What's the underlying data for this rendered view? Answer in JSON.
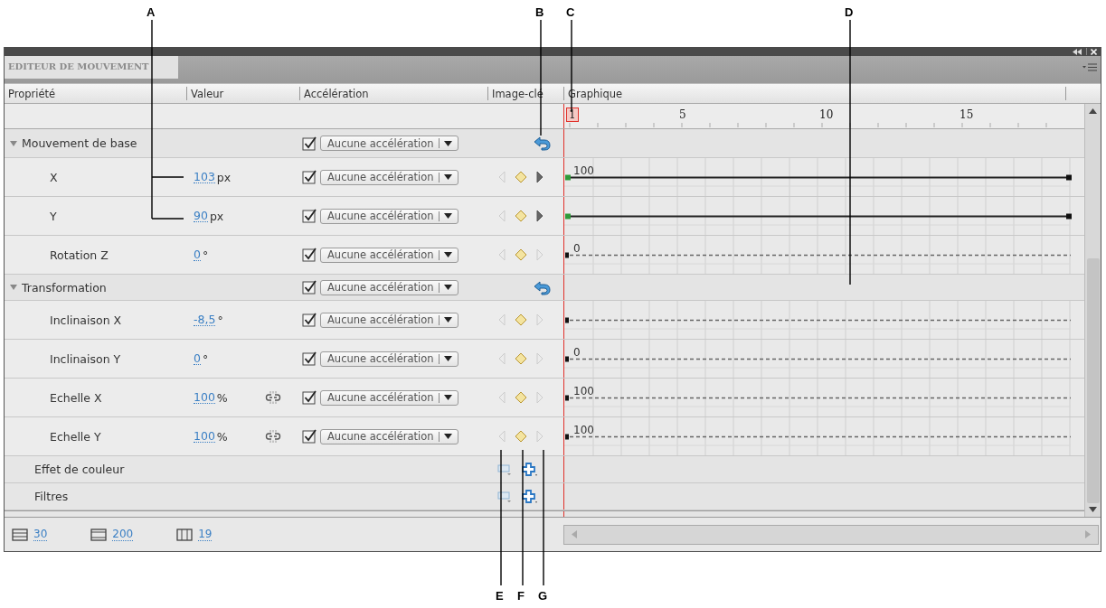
{
  "panel": {
    "tab": "EDITEUR DE MOUVEMENT"
  },
  "columns": [
    "Propriété",
    "Valeur",
    "Accélération",
    "Image-clé",
    "Graphique"
  ],
  "ruler": {
    "current": "1",
    "labels": [
      "5",
      "10",
      "15"
    ]
  },
  "rows": [
    {
      "kind": "group",
      "label": "Mouvement de base",
      "expanded": true,
      "easing_checked": true,
      "easing": "Aucune accélération"
    },
    {
      "kind": "property",
      "label": "X",
      "value": "103",
      "unit": "px",
      "link_icon": false,
      "easing_checked": true,
      "easing": "Aucune accélération",
      "prev_enabled": false,
      "next_enabled": true,
      "graph": {
        "kind": "solid",
        "label": "100"
      }
    },
    {
      "kind": "property",
      "label": "Y",
      "value": "90",
      "unit": "px",
      "link_icon": false,
      "easing_checked": true,
      "easing": "Aucune accélération",
      "prev_enabled": false,
      "next_enabled": true,
      "graph": {
        "kind": "solid"
      }
    },
    {
      "kind": "property",
      "label": "Rotation Z",
      "value": "0",
      "unit": "°",
      "link_icon": false,
      "easing_checked": true,
      "easing": "Aucune accélération",
      "prev_enabled": false,
      "next_enabled": false,
      "graph": {
        "kind": "dashed",
        "label": "0"
      }
    },
    {
      "kind": "group",
      "label": "Transformation",
      "expanded": true,
      "easing_checked": true,
      "easing": "Aucune accélération"
    },
    {
      "kind": "property",
      "label": "Inclinaison X",
      "value": "-8,5",
      "unit": "°",
      "link_icon": false,
      "easing_checked": true,
      "easing": "Aucune accélération",
      "prev_enabled": false,
      "next_enabled": false,
      "graph": {
        "kind": "dashed"
      }
    },
    {
      "kind": "property",
      "label": "Inclinaison Y",
      "value": "0",
      "unit": "°",
      "link_icon": false,
      "easing_checked": true,
      "easing": "Aucune accélération",
      "prev_enabled": false,
      "next_enabled": false,
      "graph": {
        "kind": "dashed",
        "label": "0"
      }
    },
    {
      "kind": "property",
      "label": "Echelle X",
      "value": "100",
      "unit": "%",
      "link_icon": true,
      "easing_checked": true,
      "easing": "Aucune accélération",
      "prev_enabled": false,
      "next_enabled": false,
      "graph": {
        "kind": "dashed",
        "label": "100"
      }
    },
    {
      "kind": "property",
      "label": "Echelle Y",
      "value": "100",
      "unit": "%",
      "link_icon": true,
      "easing_checked": true,
      "easing": "Aucune accélération",
      "prev_enabled": false,
      "next_enabled": false,
      "graph": {
        "kind": "dashed",
        "label": "100"
      }
    },
    {
      "kind": "section",
      "label": "Effet de couleur"
    },
    {
      "kind": "section",
      "label": "Filtres"
    }
  ],
  "footer": [
    "30",
    "200",
    "19"
  ],
  "callouts": [
    "A",
    "B",
    "C",
    "D",
    "E",
    "F",
    "G"
  ]
}
